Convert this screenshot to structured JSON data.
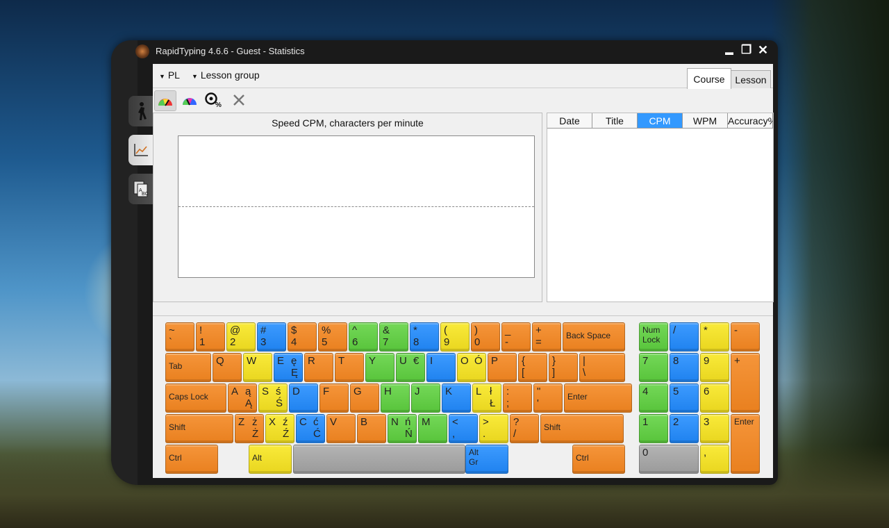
{
  "window": {
    "title": "RapidTyping 4.6.6 - Guest - Statistics",
    "minimize": "▬",
    "restore": "❐",
    "close": "✕"
  },
  "menu": {
    "language": "PL",
    "group": "Lesson group"
  },
  "tabs": [
    {
      "label": "Course",
      "active": true
    },
    {
      "label": "Lesson",
      "active": false
    }
  ],
  "chart": {
    "title": "Speed CPM, characters per minute"
  },
  "chart_data": {
    "type": "line",
    "title": "Speed CPM, characters per minute",
    "series": []
  },
  "table": {
    "columns": [
      "Date",
      "Title",
      "CPM",
      "WPM",
      "Accuracy%"
    ],
    "selected": "CPM",
    "rows": []
  },
  "keyboard": {
    "colors": {
      "orange": "#ef8a2c",
      "yellow": "#f3e02c",
      "blue": "#2f8ff7",
      "green": "#66ce49",
      "gray": "#a8a8a8"
    },
    "rows": [
      [
        [
          "~",
          "`",
          null,
          null,
          "o"
        ],
        [
          "!",
          "1",
          null,
          null,
          "o"
        ],
        [
          "@",
          "2",
          null,
          null,
          "y"
        ],
        [
          "#",
          "3",
          null,
          null,
          "b"
        ],
        [
          "$",
          "4",
          null,
          null,
          "o"
        ],
        [
          "%",
          "5",
          null,
          null,
          "o"
        ],
        [
          "^",
          "6",
          null,
          null,
          "g"
        ],
        [
          "&",
          "7",
          null,
          null,
          "g"
        ],
        [
          "*",
          "8",
          null,
          null,
          "b"
        ],
        [
          "(",
          "9",
          null,
          null,
          "y"
        ],
        [
          ")",
          "0",
          null,
          null,
          "o"
        ],
        [
          "_",
          "-",
          null,
          null,
          "o"
        ],
        [
          "+",
          "=",
          null,
          null,
          "o"
        ],
        [
          "Back Space",
          null,
          null,
          null,
          "o"
        ]
      ],
      [
        [
          "Tab",
          null,
          null,
          null,
          "o"
        ],
        [
          "Q",
          null,
          null,
          null,
          "o"
        ],
        [
          "W",
          null,
          null,
          null,
          "y"
        ],
        [
          "E",
          "",
          "ę",
          "Ę",
          "b"
        ],
        [
          "R",
          null,
          null,
          null,
          "o"
        ],
        [
          "T",
          null,
          null,
          null,
          "o"
        ],
        [
          "Y",
          null,
          null,
          null,
          "g"
        ],
        [
          "U",
          "",
          "€",
          "",
          "g"
        ],
        [
          "I",
          null,
          null,
          null,
          "b"
        ],
        [
          "O",
          "",
          "Ó",
          "",
          "y"
        ],
        [
          "P",
          null,
          null,
          null,
          "o"
        ],
        [
          "{",
          "[",
          null,
          null,
          "o"
        ],
        [
          "}",
          "]",
          null,
          null,
          "o"
        ],
        [
          "|",
          "\\",
          null,
          null,
          "o"
        ]
      ],
      [
        [
          "Caps Lock",
          null,
          null,
          null,
          "o"
        ],
        [
          "A",
          "",
          "ą",
          "Ą",
          "o"
        ],
        [
          "S",
          "",
          "ś",
          "Ś",
          "y"
        ],
        [
          "D",
          null,
          null,
          null,
          "b"
        ],
        [
          "F",
          null,
          null,
          null,
          "o"
        ],
        [
          "G",
          null,
          null,
          null,
          "o"
        ],
        [
          "H",
          null,
          null,
          null,
          "g"
        ],
        [
          "J",
          null,
          null,
          null,
          "g"
        ],
        [
          "K",
          null,
          null,
          null,
          "b"
        ],
        [
          "L",
          "",
          "ł",
          "Ł",
          "y"
        ],
        [
          ":",
          ";",
          null,
          null,
          "o"
        ],
        [
          "\"",
          "'",
          null,
          null,
          "o"
        ],
        [
          "Enter",
          null,
          null,
          null,
          "o"
        ]
      ],
      [
        [
          "Shift",
          null,
          null,
          null,
          "o"
        ],
        [
          "Z",
          "",
          "ż",
          "Ż",
          "o"
        ],
        [
          "X",
          "",
          "ź",
          "Ź",
          "y"
        ],
        [
          "C",
          "",
          "ć",
          "Ć",
          "b"
        ],
        [
          "V",
          null,
          null,
          null,
          "o"
        ],
        [
          "B",
          null,
          null,
          null,
          "o"
        ],
        [
          "N",
          "",
          "ń",
          "Ń",
          "g"
        ],
        [
          "M",
          null,
          null,
          null,
          "g"
        ],
        [
          "<",
          ",",
          null,
          null,
          "b"
        ],
        [
          ">",
          ".",
          null,
          null,
          "y"
        ],
        [
          "?",
          "/",
          null,
          null,
          "o"
        ],
        [
          "Shift",
          null,
          null,
          null,
          "o"
        ]
      ],
      [
        [
          "Ctrl",
          null,
          null,
          null,
          "o"
        ],
        [
          "Alt",
          null,
          null,
          null,
          "y"
        ],
        [
          "",
          null,
          null,
          null,
          "gr"
        ],
        [
          "Alt Gr",
          null,
          null,
          null,
          "b"
        ],
        [
          "Ctrl",
          null,
          null,
          null,
          "o"
        ]
      ]
    ],
    "numpad": [
      [
        "Num Lock",
        "g"
      ],
      [
        "/",
        "b"
      ],
      [
        "*",
        "y"
      ],
      [
        "-",
        "o"
      ],
      [
        "7",
        "g"
      ],
      [
        "8",
        "b"
      ],
      [
        "9",
        "y"
      ],
      [
        "+",
        "o"
      ],
      [
        "4",
        "g"
      ],
      [
        "5",
        "b"
      ],
      [
        "6",
        "y"
      ],
      [
        "1",
        "g"
      ],
      [
        "2",
        "b"
      ],
      [
        "3",
        "y"
      ],
      [
        "Enter",
        "o"
      ],
      [
        "0",
        "gr"
      ],
      [
        ",",
        "y"
      ]
    ]
  }
}
